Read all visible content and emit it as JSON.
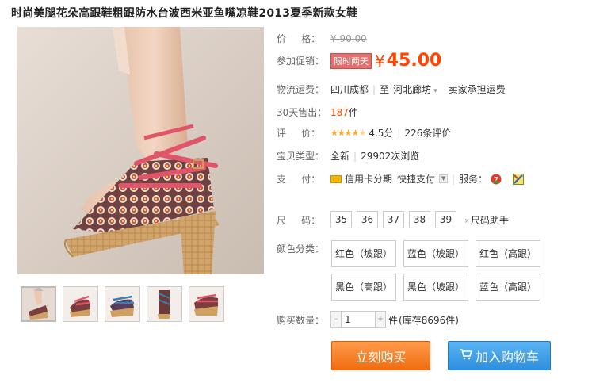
{
  "title": "时尚美腿花朵高跟鞋粗跟防水台波西米亚鱼嘴凉鞋2013夏季新款女鞋",
  "price": {
    "label": "价     格：",
    "original": "¥ 90.00"
  },
  "promo": {
    "label": "参加促销：",
    "tag": "限时两天",
    "currency": "¥",
    "value": "45.00"
  },
  "shipping": {
    "label": "物流运费：",
    "from": "四川成都",
    "sep": "|",
    "to_prefix": "至",
    "to": "河北廊坊",
    "note": "卖家承担运费"
  },
  "sales": {
    "label": "30天售出：",
    "count": "187",
    "unit": "件"
  },
  "rating": {
    "label": "评     价：",
    "stars_filled": "★★★★",
    "stars_half": "★",
    "score": "4.5分",
    "sep": "|",
    "reviews": "226条评价"
  },
  "type": {
    "label": "宝贝类型：",
    "value": "全新",
    "sep": "|",
    "views": "29902次浏览"
  },
  "payment": {
    "label": "支     付：",
    "credit": "信用卡分期",
    "quick": "快捷支付",
    "service_sep": "|",
    "service_label": "服务："
  },
  "size": {
    "label": "尺     码：",
    "options": [
      "35",
      "36",
      "37",
      "38",
      "39"
    ],
    "help": "尺码助手"
  },
  "color": {
    "label": "颜色分类：",
    "options": [
      "红色（坡跟）",
      "蓝色（坡跟）",
      "红色（高跟）",
      "黑色（高跟）",
      "黑色（坡跟）",
      "蓝色（高跟）"
    ]
  },
  "quantity": {
    "label": "购买数量：",
    "value": "1",
    "unit": "件",
    "stock": "(库存8696件)",
    "minus": "-",
    "plus": "+"
  },
  "buttons": {
    "buy": "立刻购买",
    "cart": "加入购物车"
  },
  "colors": {
    "accent": "#ff4400",
    "buy_btn": "#f06d10",
    "cart_btn": "#2e8fe0",
    "star": "#f5a623"
  },
  "icons": [
    "credit-card-icon",
    "dropdown-icon",
    "seven-day-return-icon",
    "guarantee-icon",
    "cart-icon",
    "chevron-right-icon"
  ]
}
